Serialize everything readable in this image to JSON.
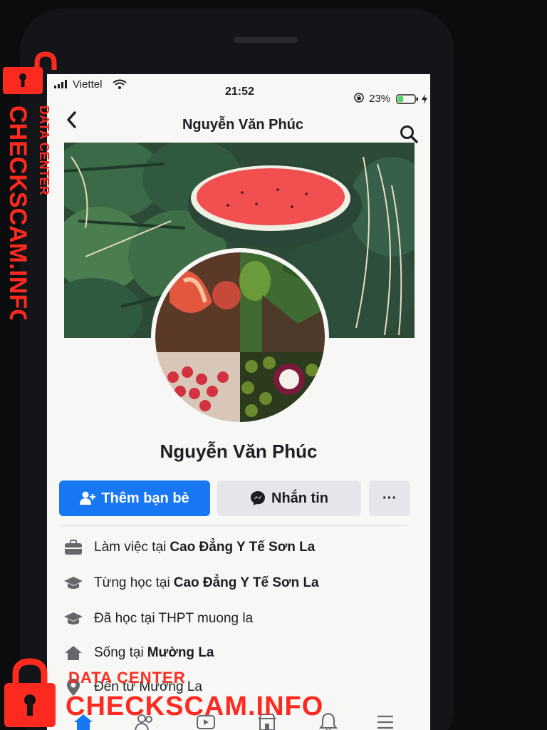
{
  "status_bar": {
    "carrier": "Viettel",
    "time": "21:52",
    "battery": "23%"
  },
  "header": {
    "title": "Nguyễn Văn Phúc",
    "icons": [
      "back-icon",
      "search-icon"
    ]
  },
  "profile": {
    "name": "Nguyễn Văn Phúc"
  },
  "actions": {
    "add_friend": "Thêm bạn bè",
    "message": "Nhắn tin",
    "more": "···"
  },
  "info": [
    {
      "icon": "briefcase-icon",
      "prefix": "Làm việc tại",
      "value": "Cao Đẳng Y Tế Sơn La"
    },
    {
      "icon": "graduation-cap-icon",
      "prefix": "Từng học tại",
      "value": "Cao Đẳng Y Tế Sơn La"
    },
    {
      "icon": "graduation-cap-icon",
      "prefix": "Đã học tại THPT muong la",
      "value": ""
    },
    {
      "icon": "home-icon",
      "prefix": "Sống tại",
      "value": "Mường La"
    },
    {
      "icon": "location-pin-icon",
      "prefix": "Đến từ Mường La",
      "value": ""
    }
  ],
  "tab_bar": [
    "home-tab-icon",
    "friends-tab-icon",
    "video-tab-icon",
    "marketplace-tab-icon",
    "notifications-tab-icon",
    "menu-tab-icon"
  ],
  "watermark": {
    "top": "DATA CENTER",
    "main": "CHECKSCAM.INFO"
  },
  "colors": {
    "accent": "#1877f2",
    "watermark": "#ff2a1f"
  }
}
